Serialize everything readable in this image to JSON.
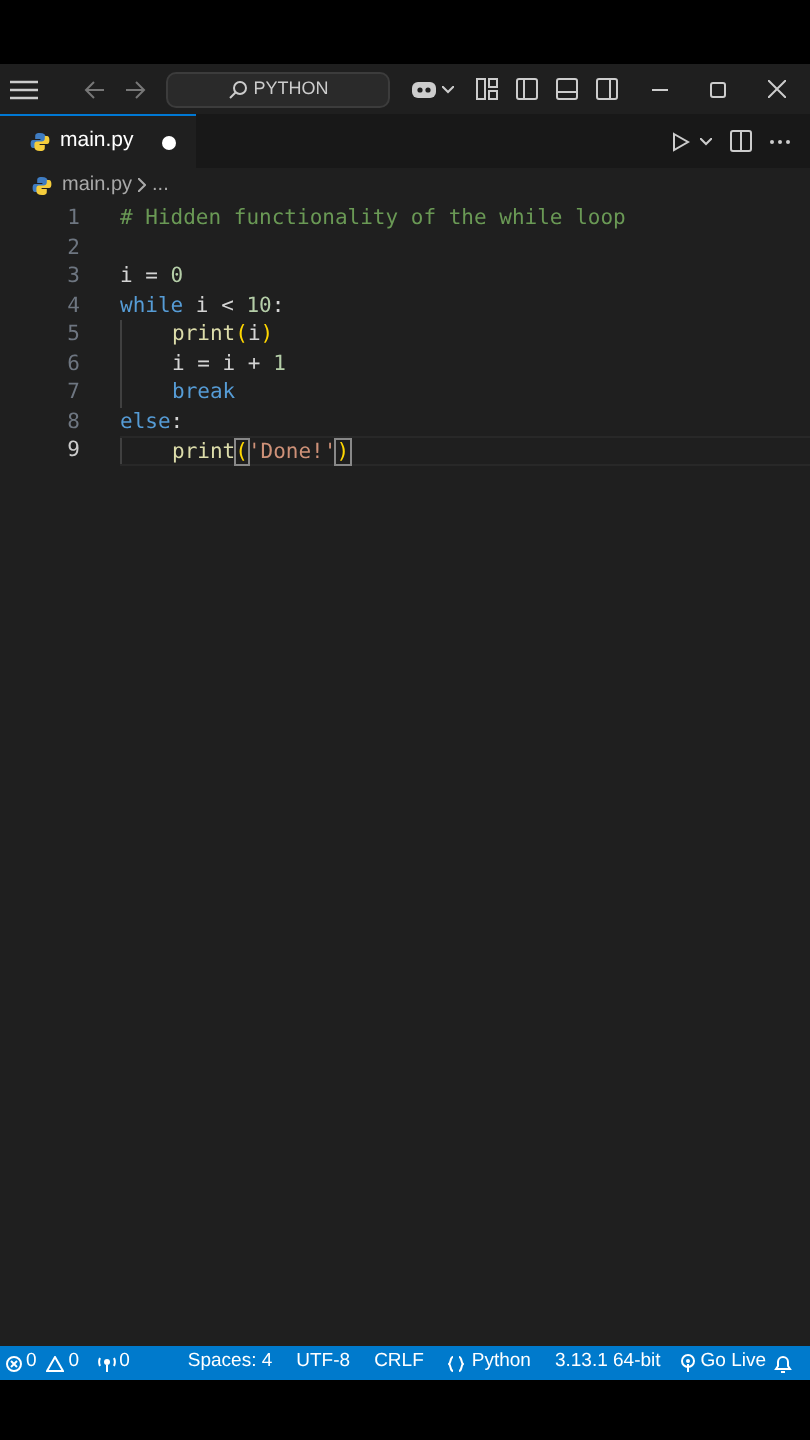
{
  "title_bar": {
    "search": "PYTHON"
  },
  "tabs": [
    {
      "label": "main.py",
      "selected": true,
      "modified": true
    }
  ],
  "breadcrumb": [
    "main.py",
    "..."
  ],
  "code_lines": [
    {
      "number": "1",
      "current": false,
      "tokens": [
        {
          "text": "# Hidden functionality of the while loop",
          "kind": "comment"
        }
      ]
    },
    {
      "number": "2",
      "current": false
    },
    {
      "number": "3",
      "current": false,
      "tokens": [
        {
          "text": "i = ",
          "kind": "plain"
        },
        {
          "text": "0",
          "kind": "number"
        }
      ]
    },
    {
      "number": "4",
      "current": false,
      "tokens": [
        {
          "text": "while",
          "kind": "keyword"
        },
        {
          "text": " i < ",
          "kind": "plain"
        },
        {
          "text": "10",
          "kind": "number"
        },
        {
          "text": ":",
          "kind": "plain"
        }
      ]
    },
    {
      "number": "5",
      "current": false,
      "indented": true,
      "tokens": [
        {
          "text": "print",
          "kind": "function"
        },
        {
          "text": "(",
          "kind": "paren"
        },
        {
          "text": "i",
          "kind": "plain"
        },
        {
          "text": ")",
          "kind": "paren"
        }
      ]
    },
    {
      "number": "6",
      "current": false,
      "indented": true,
      "tokens": [
        {
          "text": "i = i + ",
          "kind": "plain"
        },
        {
          "text": "1",
          "kind": "number"
        }
      ]
    },
    {
      "number": "7",
      "current": false,
      "indented": true,
      "tokens": [
        {
          "text": "break",
          "kind": "keyword"
        }
      ]
    },
    {
      "number": "8",
      "current": false,
      "tokens": [
        {
          "text": "else",
          "kind": "keyword"
        },
        {
          "text": ":",
          "kind": "plain"
        }
      ]
    },
    {
      "number": "9",
      "current": true,
      "indented": true,
      "tokens": [
        {
          "text": "print",
          "kind": "function"
        },
        {
          "text": "(",
          "kind": "match"
        },
        {
          "text": "'Done!'",
          "kind": "string"
        },
        {
          "text": ")",
          "kind": "match"
        }
      ]
    }
  ],
  "status_bar": {
    "errors": "0",
    "warnings": "0",
    "ports": "0",
    "items": [
      "Spaces: 4",
      "UTF-8",
      "CRLF"
    ],
    "language": "Python",
    "interpreter": "3.13.1 64-bit",
    "live": "Go Live"
  }
}
